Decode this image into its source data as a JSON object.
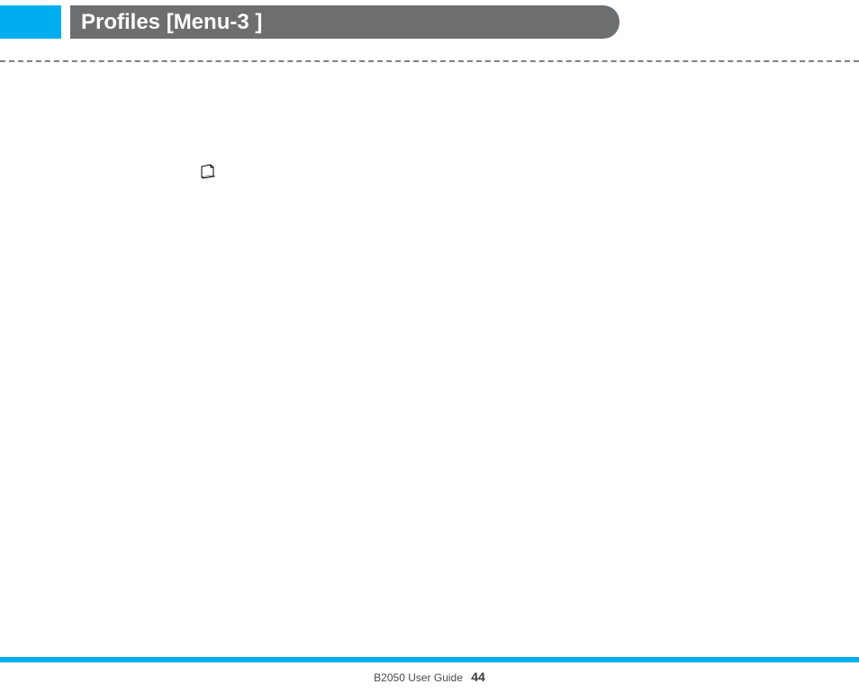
{
  "header": {
    "title": "Profiles [Menu-3 ]"
  },
  "footer": {
    "guide_label": "B2050 User Guide",
    "page_number": "44"
  }
}
